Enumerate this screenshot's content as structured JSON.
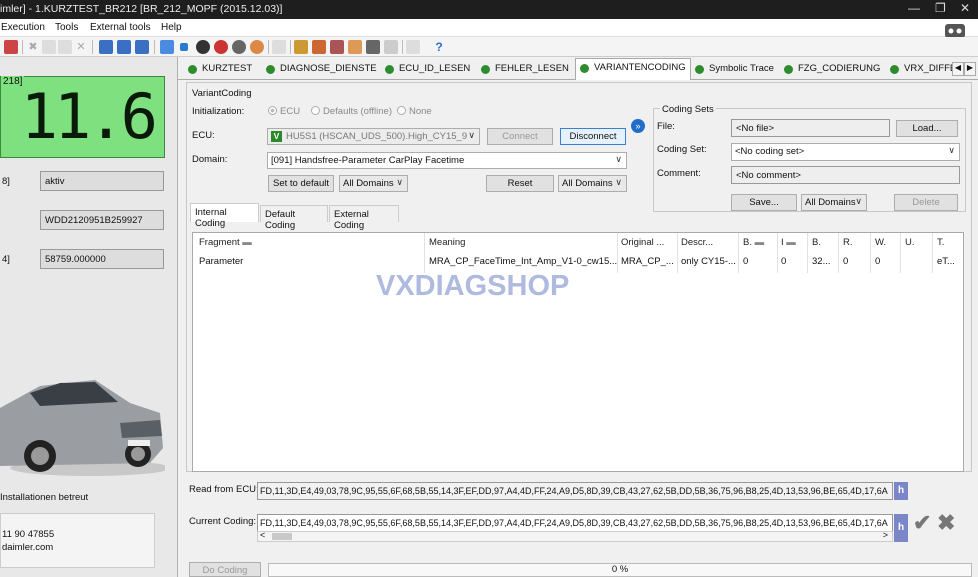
{
  "window": {
    "title": "imler] - 1.KURZTEST_BR212 [BR_212_MOPF (2015.12.03)]"
  },
  "menu": {
    "execution": "Execution",
    "tools": "Tools",
    "external_tools": "External tools",
    "help": "Help"
  },
  "left_panel": {
    "lcd_header": "218]",
    "lcd_value": "11.6",
    "rows": [
      {
        "key": "8]",
        "value": "aktiv"
      },
      {
        "key": "",
        "value": "WDD2120951B259927"
      },
      {
        "key": "4]",
        "value": "58759.000000"
      }
    ],
    "info_text": "Installationen betreut",
    "phone": "11 90 47855",
    "email": "daimler.com"
  },
  "tabs": [
    {
      "label": "KURZTEST",
      "active": false
    },
    {
      "label": "DIAGNOSE_DIENSTE",
      "active": false
    },
    {
      "label": "ECU_ID_LESEN",
      "active": false
    },
    {
      "label": "FEHLER_LESEN",
      "active": false
    },
    {
      "label": "VARIANTENCODING",
      "active": true
    },
    {
      "label": "Symbolic Trace",
      "active": false
    },
    {
      "label": "FZG_CODIERUNG",
      "active": false
    },
    {
      "label": "VRX_DIFFE",
      "active": false
    }
  ],
  "variant_coding": {
    "group_title": "VariantCoding",
    "initialization_label": "Initialization:",
    "radio_ecu": "ECU",
    "radio_defaults": "Defaults (offline)",
    "radio_none": "None",
    "ecu_label": "ECU:",
    "ecu_badge": "V",
    "ecu_value": "HU5S1 (HSCAN_UDS_500).High_CY15_9",
    "connect_label": "Connect",
    "disconnect_label": "Disconnect",
    "domain_label": "Domain:",
    "domain_value": "[091] Handsfree-Parameter CarPlay Facetime",
    "set_default_label": "Set to default",
    "all_domains_1": "All Domains",
    "reset_label": "Reset",
    "all_domains_2": "All Domains"
  },
  "coding_sets": {
    "title": "Coding Sets",
    "file_label": "File:",
    "file_value": "<No file>",
    "load_label": "Load...",
    "coding_set_label": "Coding Set:",
    "coding_set_value": "<No coding set>",
    "comment_label": "Comment:",
    "comment_value": "<No comment>",
    "save_label": "Save...",
    "all_domains": "All Domains",
    "delete_label": "Delete"
  },
  "inner_tabs": [
    "Internal Coding",
    "Default Coding",
    "External Coding"
  ],
  "grid": {
    "headers": [
      "Fragment",
      "Meaning",
      "Original ...",
      "Descr...",
      "B.",
      "I",
      "B.",
      "R.",
      "W.",
      "U.",
      "T."
    ],
    "rows": [
      [
        "Parameter",
        "MRA_CP_FaceTime_Int_Amp_V1-0_cw15...",
        "MRA_CP_...",
        "only CY15-...",
        "0",
        "0",
        "32...",
        "0",
        "0",
        "",
        "eT..."
      ]
    ]
  },
  "watermark": "VXDIAGSHOP",
  "read_from_ecu": {
    "label": "Read from ECU:",
    "value": "FD,11,3D,E4,49,03,78,9C,95,55,6F,68,5B,55,14,3F,EF,DD,97,A4,4D,FF,24,A9,D5,8D,39,CB,43,27,62,5B,DD,5B,36,75,96,B8,25,4D,13,53,96,BE,65,4D,17,6A",
    "hex_button": "h"
  },
  "current_coding": {
    "label": "Current Coding:",
    "value": "FD,11,3D,E4,49,03,78,9C,95,55,6F,68,5B,55,14,3F,EF,DD,97,A4,4D,FF,24,A9,D5,8D,39,CB,43,27,62,5B,DD,5B,36,75,96,B8,25,4D,13,53,96,BE,65,4D,17,6A",
    "hex_button": "h"
  },
  "do_coding_label": "Do Coding",
  "progress": {
    "value": 0,
    "text": "0 %"
  },
  "colors": {
    "lcd_green": "#7fe07f",
    "tab_dot": "#2e8b2e",
    "hex_button": "#7a86c8"
  }
}
